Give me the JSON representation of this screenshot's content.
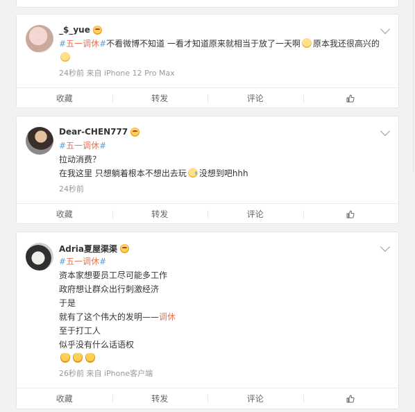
{
  "toolbar": {
    "favorite_label": "收藏",
    "repost_label": "转发",
    "comment_label": "评论"
  },
  "posts": [
    {
      "username": "_$_yue",
      "hashtag": "#五一调休#",
      "lines": [
        "不看微博不知道 一看才知道原来就相当于放了一天啊",
        "原本我还很高兴的"
      ],
      "meta": "24秒前  来自 iPhone 12 Pro Max"
    },
    {
      "username": "Dear-CHEN777",
      "hashtag": "#五一调休#",
      "lines": [
        "拉动消费？",
        "在我这里 只想躺着根本不想出去玩",
        "没想到吧hhh"
      ],
      "meta": "24秒前"
    },
    {
      "username": "Adria夏屋渠渠",
      "hashtag": "#五一调休#",
      "lines": [
        "资本家想要员工尽可能多工作",
        "政府想让群众出行刺激经济",
        "于是",
        "就有了这个伟大的发明——",
        "调休",
        "至于打工人",
        "似乎没有什么话语权"
      ],
      "meta": "26秒前  来自 iPhone客户端"
    }
  ],
  "icons": [
    "chevron-down-icon",
    "like-icon",
    "vip-badge-icon"
  ],
  "colors": {
    "hashtag": "#eb7350",
    "link": "#5d9ed8",
    "meta": "#999999"
  }
}
